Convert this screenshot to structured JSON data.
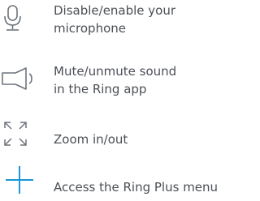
{
  "items": [
    {
      "icon": "microphone-icon",
      "lines": [
        "Disable/enable your",
        "microphone"
      ]
    },
    {
      "icon": "speaker-icon",
      "lines": [
        "Mute/unmute sound",
        "in the Ring app"
      ]
    },
    {
      "icon": "zoom-arrows-icon",
      "lines": [
        "Zoom in/out"
      ]
    },
    {
      "icon": "plus-icon",
      "lines": [
        "Access the Ring Plus menu"
      ]
    }
  ],
  "colors": {
    "text": "#4b4f55",
    "icon_gray": "#6e747b",
    "icon_blue": "#1998d5"
  }
}
